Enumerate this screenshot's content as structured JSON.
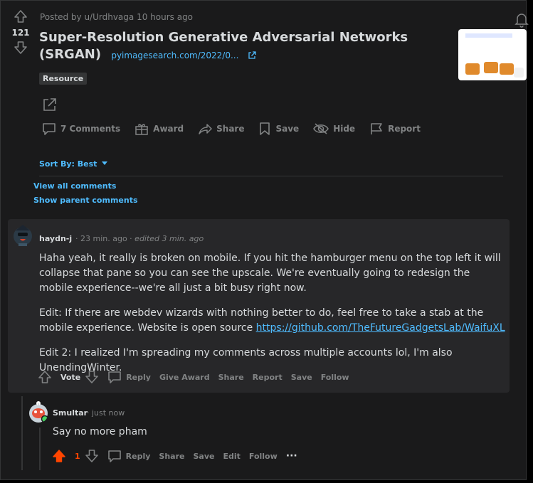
{
  "post": {
    "meta": "Posted by u/Urdhvaga 10 hours ago",
    "score": "121",
    "title": "Super-Resolution Generative Adversarial Networks (SRGAN)",
    "domain": "pyimagesearch.com/2022/0...",
    "flair": "Resource"
  },
  "actions": {
    "comments": "7 Comments",
    "award": "Award",
    "share": "Share",
    "save": "Save",
    "hide": "Hide",
    "report": "Report"
  },
  "sort": {
    "label": "Sort By: Best"
  },
  "links": {
    "view_all": "View all comments",
    "show_parent": "Show parent comments"
  },
  "comment1": {
    "author": "haydn-j",
    "time": "· 23 min. ago ·",
    "edited": "edited 3 min. ago",
    "p1": "Haha yeah, it really is broken on mobile. If you hit the hamburger menu on the top left it will collapse that pane so you can see the upscale. We're eventually going to redesign the mobile experience--we're all just a bit busy right now.",
    "p2_text": "Edit: If there are webdev wizards with nothing better to do, feel free to take a stab at the mobile experience. Website is open source ",
    "p2_link": "https://github.com/TheFutureGadgetsLab/WaifuXL",
    "p3": "Edit 2: I realized I'm spreading my comments across multiple accounts lol, I'm also UnendingWinter.",
    "vote": "Vote",
    "reply": "Reply",
    "give_award": "Give Award",
    "share": "Share",
    "report": "Report",
    "save": "Save",
    "follow": "Follow"
  },
  "comment2": {
    "author": "Smultar",
    "time": "· just now",
    "body": "Say no more pham",
    "score": "1",
    "reply": "Reply",
    "share": "Share",
    "save": "Save",
    "edit": "Edit",
    "follow": "Follow",
    "more": "···"
  },
  "colors": {
    "background": "#1a1a1b",
    "comment_bg": "#272729",
    "link": "#4fbcff",
    "upvote": "#ff4500",
    "muted": "#818384"
  }
}
